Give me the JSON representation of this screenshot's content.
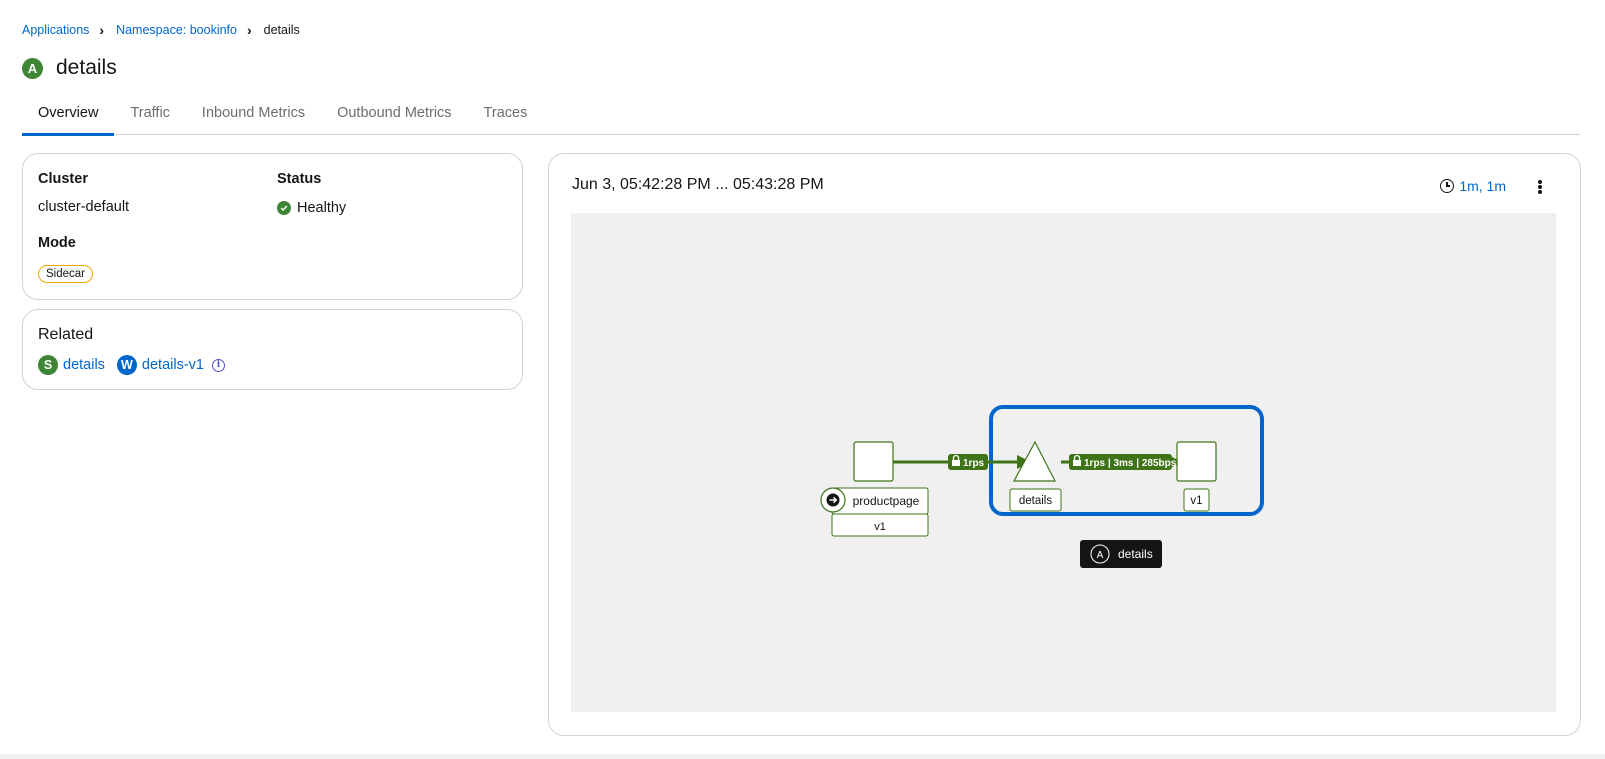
{
  "breadcrumb": {
    "applications": "Applications",
    "namespace": "Namespace: bookinfo",
    "current": "details"
  },
  "header": {
    "badge": "A",
    "title": "details"
  },
  "tabs": [
    {
      "label": "Overview",
      "active": true
    },
    {
      "label": "Traffic",
      "active": false
    },
    {
      "label": "Inbound Metrics",
      "active": false
    },
    {
      "label": "Outbound Metrics",
      "active": false
    },
    {
      "label": "Traces",
      "active": false
    }
  ],
  "info": {
    "cluster_label": "Cluster",
    "cluster_value": "cluster-default",
    "status_label": "Status",
    "status_value": "Healthy",
    "mode_label": "Mode",
    "mode_value": "Sidecar"
  },
  "related": {
    "title": "Related",
    "service_badge": "S",
    "service": "details",
    "workload_badge": "W",
    "workload": "details-v1"
  },
  "graph": {
    "time_window": "Jun 3, 05:42:28 PM ... 05:43:28 PM",
    "duration": "1m, 1m",
    "nodes": {
      "productpage": "productpage",
      "productpage_version": "v1",
      "details": "details",
      "details_version": "v1"
    },
    "edges": {
      "to_details": "1rps",
      "to_v1": "1rps | 3ms | 285bps"
    },
    "box_badge": "A",
    "box_label": "details"
  },
  "colors": {
    "link": "#0066cc",
    "healthy": "#3e8635",
    "edge": "#3e7318",
    "app_box": "#0066cc",
    "mode_border": "#f0ab00"
  }
}
